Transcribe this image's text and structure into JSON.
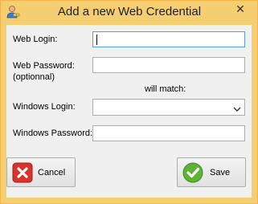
{
  "window": {
    "title": "Add a new Web Credential",
    "close_glyph": "✕"
  },
  "form": {
    "web_login_label": "Web Login:",
    "web_login_value": "",
    "web_password_label_line1": "Web Password:",
    "web_password_label_line2": "(optionnal)",
    "web_password_value": "",
    "will_match_text": "will match:",
    "windows_login_label": "Windows Login:",
    "windows_login_selected": "",
    "windows_password_label": "Windows Password:",
    "windows_password_value": ""
  },
  "buttons": {
    "cancel_label": "Cancel",
    "save_label": "Save"
  },
  "icons": {
    "app": "user-key-icon",
    "cancel": "red-x-icon",
    "save": "green-check-icon"
  },
  "colors": {
    "title_bar": "#f5ce72",
    "cancel_icon": "#d9342b",
    "save_icon": "#5db336"
  }
}
